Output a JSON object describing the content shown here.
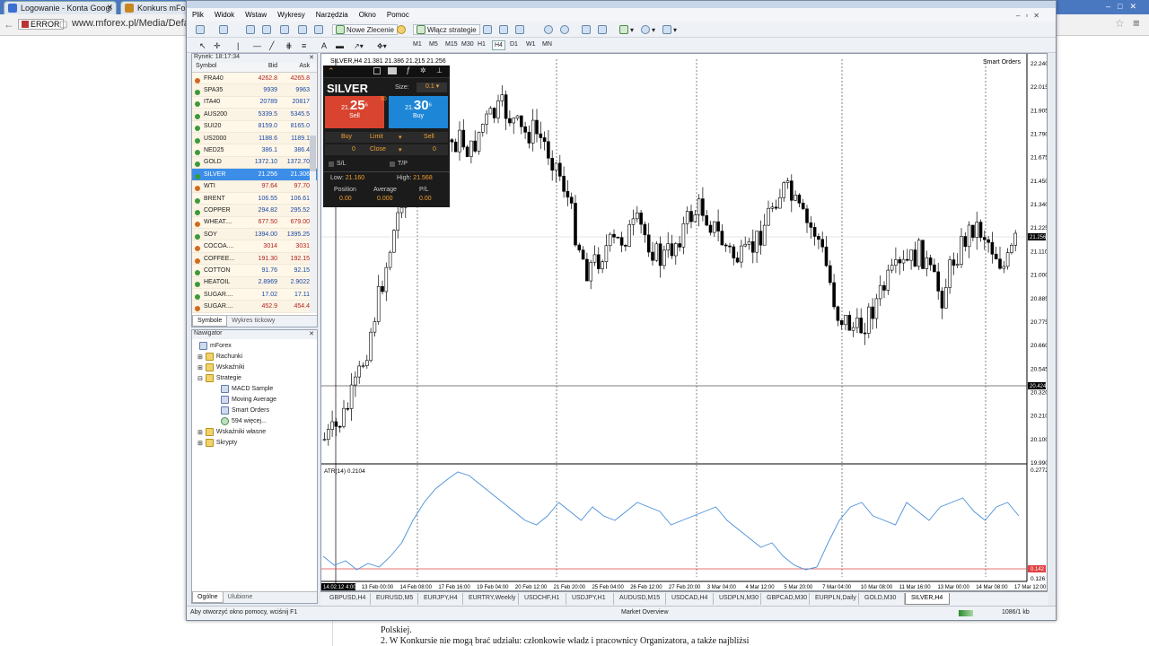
{
  "browser": {
    "tabs": [
      {
        "label": "Logowanie - Konta Googl",
        "color": "#3b6fd1"
      },
      {
        "label": "Konkurs mForex",
        "color": "#c7871f"
      }
    ],
    "error_label": "ERROR",
    "address": "www.mforex.pl/Media/Defa"
  },
  "document": {
    "line1": "Polskiej.",
    "line2": "2. W Konkursie nie mogą brać udziału: członkowie władz i pracownicy Organizatora, a także najbliżsi"
  },
  "menu": [
    "Plik",
    "Widok",
    "Wstaw",
    "Wykresy",
    "Narzędzia",
    "Okno",
    "Pomoc"
  ],
  "toolbar": {
    "new_order": "Nowe Zlecenie",
    "strategies": "Włącz strategie",
    "timeframes": [
      "M1",
      "M5",
      "M15",
      "M30",
      "H1",
      "H4",
      "D1",
      "W1",
      "MN"
    ],
    "selected_tf": "H4",
    "text_tool": "A"
  },
  "market_watch": {
    "title": "Rynek: 18:17:34",
    "col_symbol": "Symbol",
    "col_bid": "Bid",
    "col_ask": "Ask",
    "rows": [
      {
        "s": "FRA40",
        "b": "4262.8",
        "a": "4265.8",
        "dir": "r"
      },
      {
        "s": "SPA35",
        "b": "9939",
        "a": "9963",
        "dir": "g"
      },
      {
        "s": "ITA40",
        "b": "20789",
        "a": "20817",
        "dir": "g"
      },
      {
        "s": "AUS200",
        "b": "5339.5",
        "a": "5345.5",
        "dir": "g"
      },
      {
        "s": "SUI20",
        "b": "8159.0",
        "a": "8165.0",
        "dir": "g"
      },
      {
        "s": "US2000",
        "b": "1188.6",
        "a": "1189.1",
        "dir": "g"
      },
      {
        "s": "NED25",
        "b": "386.1",
        "a": "386.4",
        "dir": "g"
      },
      {
        "s": "GOLD",
        "b": "1372.10",
        "a": "1372.70",
        "dir": "g"
      },
      {
        "s": "SILVER",
        "b": "21.256",
        "a": "21.306",
        "dir": "sel"
      },
      {
        "s": "WTI",
        "b": "97.64",
        "a": "97.70",
        "dir": "r"
      },
      {
        "s": "BRENT",
        "b": "106.55",
        "a": "106.61",
        "dir": "g"
      },
      {
        "s": "COPPER",
        "b": "294.82",
        "a": "295.52",
        "dir": "g"
      },
      {
        "s": "WHEAT....",
        "b": "677.50",
        "a": "679.00",
        "dir": "r"
      },
      {
        "s": "SOY",
        "b": "1394.00",
        "a": "1395.25",
        "dir": "g"
      },
      {
        "s": "COCOA....",
        "b": "3014",
        "a": "3031",
        "dir": "r"
      },
      {
        "s": "COFFEE...",
        "b": "191.30",
        "a": "192.15",
        "dir": "r"
      },
      {
        "s": "COTTON",
        "b": "91.76",
        "a": "92.15",
        "dir": "g"
      },
      {
        "s": "HEATOIL",
        "b": "2.8969",
        "a": "2.9022",
        "dir": "g"
      },
      {
        "s": "SUGAR....",
        "b": "17.02",
        "a": "17.11",
        "dir": "g"
      },
      {
        "s": "SUGAR....",
        "b": "452.9",
        "a": "454.4",
        "dir": "r"
      }
    ],
    "tab1": "Symbole",
    "tab2": "Wykres tickowy"
  },
  "navigator": {
    "title": "Nawigator",
    "root": "mForex",
    "accounts": "Rachunki",
    "indicators": "Wskaźniki",
    "strategies": "Strategie",
    "s1": "MACD Sample",
    "s2": "Moving Average",
    "s3": "Smart Orders",
    "s4": "594 więcej...",
    "custom": "Wskaźniki własne",
    "scripts": "Skrypty",
    "tab1": "Ogólne",
    "tab2": "Ulubione"
  },
  "chart": {
    "header": "SILVER,H4  21.381 21.386 21.215 21.256",
    "smart_orders": "Smart Orders",
    "price_axis": [
      "22.240",
      "22.015",
      "21.905",
      "21.790",
      "21.675",
      "21.450",
      "21.340",
      "21.225",
      "21.110",
      "21.000",
      "20.885",
      "20.775",
      "20.660",
      "20.545",
      "20.320",
      "20.210",
      "20.100",
      "19.990"
    ],
    "current_price": "21.256",
    "line_price": "20.424",
    "atr_label": "ATR(14) 0.2104",
    "atr_axis_top": "0.2772",
    "atr_axis_bottom": "0.126",
    "atr_current": "0.142",
    "time_axis": [
      "14.02.12 4:00",
      "13 Feb 00:00",
      "14 Feb 08:00",
      "17 Feb 16:00",
      "19 Feb 04:00",
      "20 Feb 12:00",
      "21 Feb 20:00",
      "25 Feb 04:00",
      "26 Feb 12:00",
      "27 Feb 20:00",
      "3 Mar 04:00",
      "4 Mar 12:00",
      "5 Mar 20:00",
      "7 Mar 04:00",
      "10 Mar 08:00",
      "11 Mar 16:00",
      "13 Mar 00:00",
      "14 Mar 08:00",
      "17 Mar 12:00"
    ]
  },
  "one_click": {
    "symbol": "SILVER",
    "size_label": "Size:",
    "size": "0.1",
    "spread": "50",
    "sell_int": "21.",
    "sell_big": "25",
    "sell_sup": "6",
    "sell_label": "Sell",
    "buy_int": "21.",
    "buy_big": "30",
    "buy_sup": "6",
    "buy_label": "Buy",
    "t_buy": "Buy",
    "t_limit": "Limit",
    "t_sell": "Sell",
    "zero1": "0",
    "close": "Close",
    "zero2": "0",
    "sl": "S/L",
    "tp": "T/P",
    "low_label": "Low:",
    "low": "21.160",
    "high_label": "High:",
    "high": "21.568",
    "position": "Position",
    "average": "Average",
    "pl": "P/L",
    "pos_v": "0.00",
    "avg_v": "0.000",
    "pl_v": "0.00"
  },
  "chart_tabs": [
    "GBPUSD,H4",
    "EURUSD,M5",
    "EURJPY,H4",
    "EURTRY,Weekly",
    "USDCHF,H1",
    "USDJPY,H1",
    "AUDUSD,M15",
    "USDCAD,H4",
    "USDPLN,M30",
    "GBPCAD,M30",
    "EURPLN,Daily",
    "GOLD,M30",
    "SILVER,H4"
  ],
  "status": {
    "help": "Aby otworzyć okno pomocy, wciśnij F1",
    "profile": "Market Overview",
    "traffic": "1086/1 kb"
  },
  "colors": {
    "sell": "#d8442f",
    "buy": "#1e86d6",
    "atr_line": "#4a90d9",
    "selected_row": "#3b8de8"
  }
}
